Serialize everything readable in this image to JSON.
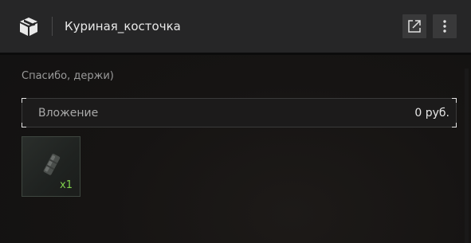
{
  "header": {
    "title": "Куриная_косточка",
    "icons": {
      "box": "box-icon",
      "open": "external-link-icon",
      "more": "more-vertical-icon"
    }
  },
  "message": {
    "text": "Спасибо, держи)"
  },
  "attachment": {
    "label": "Вложение",
    "price": "0 руб."
  },
  "items": [
    {
      "icon": "item-icon",
      "quantity": "x1"
    }
  ],
  "colors": {
    "header_bg": "#262627",
    "body_bg": "#141313",
    "quantity_green": "#7fd14c",
    "text_primary": "#e8e8e8",
    "text_secondary": "#9a9a9a"
  }
}
